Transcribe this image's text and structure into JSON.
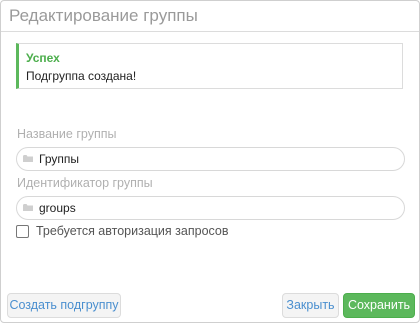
{
  "dialog": {
    "title": "Редактирование группы"
  },
  "alert": {
    "title": "Успех",
    "message": "Подгруппа создана!",
    "accent_color": "#5cb85c"
  },
  "form": {
    "name_label": "Название группы",
    "name_value": "Группы",
    "name_icon": "folder-icon",
    "id_label": "Идентификатор группы",
    "id_value": "groups",
    "id_icon": "folder-icon",
    "auth_checkbox_label": "Требуется авторизация запросов",
    "auth_checked": false
  },
  "footer": {
    "create_subgroup_label": "Создать подгруппу",
    "close_label": "Закрыть",
    "save_label": "Сохранить",
    "primary_color": "#5cb85c",
    "link_color": "#4a8fcf"
  }
}
